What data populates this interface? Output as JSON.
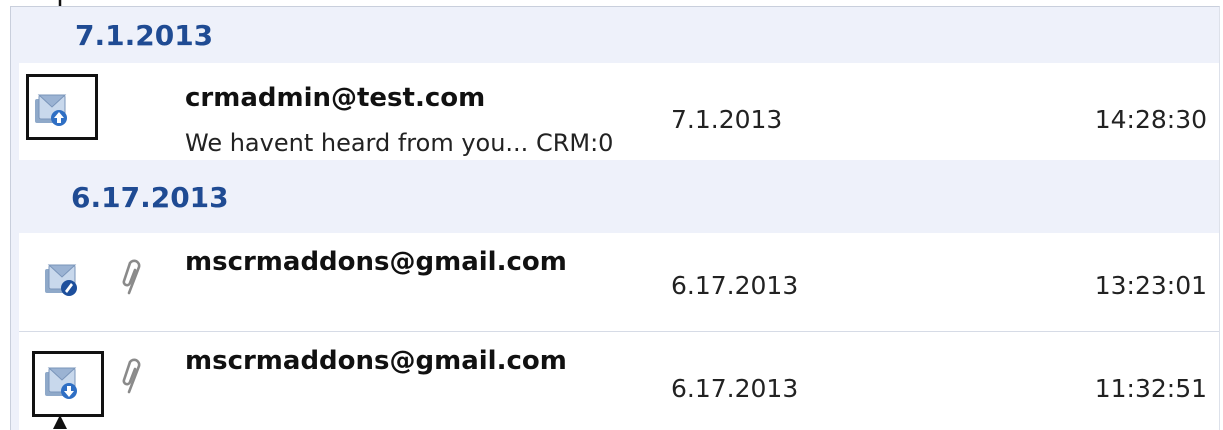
{
  "groups": [
    {
      "date_label": "7.1.2013",
      "items": [
        {
          "direction_icon": "email-outgoing-icon",
          "has_attachment": false,
          "sender": "crmadmin@test.com",
          "subject": "We havent heard from you... CRM:0",
          "date": "7.1.2013",
          "time": "14:28:30"
        }
      ]
    },
    {
      "date_label": "6.17.2013",
      "items": [
        {
          "direction_icon": "email-draft-icon",
          "has_attachment": true,
          "attachment_icon": "paperclip-icon",
          "sender": "mscrmaddons@gmail.com",
          "subject": "",
          "date": "6.17.2013",
          "time": "13:23:01"
        },
        {
          "direction_icon": "email-incoming-icon",
          "has_attachment": true,
          "attachment_icon": "paperclip-icon",
          "sender": "mscrmaddons@gmail.com",
          "subject": "",
          "date": "6.17.2013",
          "time": "11:32:51"
        }
      ]
    }
  ],
  "colors": {
    "group_header_text": "#1f4b93",
    "group_header_bg": "#eef1fa",
    "row_bg": "#ffffff",
    "callout": "#111111"
  }
}
